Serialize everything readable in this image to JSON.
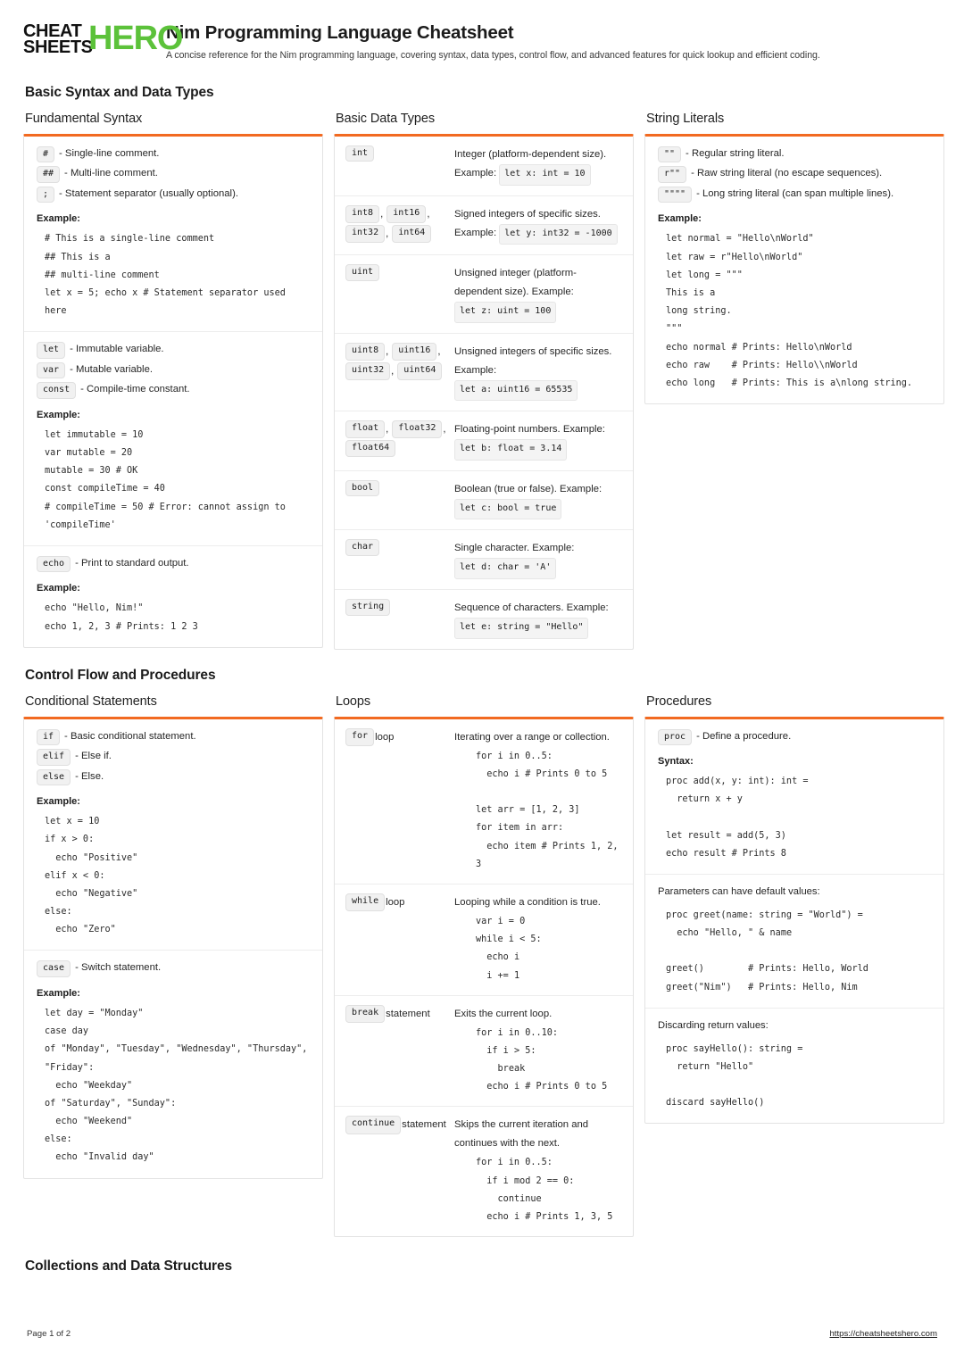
{
  "brand": {
    "line1_black": "CHEAT",
    "line2_black": "SHEETS",
    "hero": "HERO",
    "green": "#5cc23a",
    "accent": "#f26a21"
  },
  "header": {
    "title": "Nim Programming Language Cheatsheet",
    "subtitle": "A concise reference for the Nim programming language, covering syntax, data types, control flow, and advanced features for quick lookup and efficient coding."
  },
  "sections": {
    "basic": "Basic Syntax and Data Types",
    "control": "Control Flow and Procedures",
    "collections": "Collections and Data Structures"
  },
  "labels": {
    "example": "Example:",
    "syntax": "Syntax:"
  },
  "fundamental": {
    "title": "Fundamental Syntax",
    "defs1": [
      {
        "code": "#",
        "text": "- Single-line comment."
      },
      {
        "code": "##",
        "text": "- Multi-line comment."
      },
      {
        "code": ";",
        "text": "- Statement separator (usually optional)."
      }
    ],
    "example1": "# This is a single-line comment\n## This is a\n## multi-line comment\nlet x = 5; echo x # Statement separator used here",
    "defs2": [
      {
        "code": "let",
        "text": "- Immutable variable."
      },
      {
        "code": "var",
        "text": "- Mutable variable."
      },
      {
        "code": "const",
        "text": "- Compile-time constant."
      }
    ],
    "example2": "let immutable = 10\nvar mutable = 20\nmutable = 30 # OK\nconst compileTime = 40\n# compileTime = 50 # Error: cannot assign to 'compileTime'",
    "defs3": [
      {
        "code": "echo",
        "text": "- Print to standard output."
      }
    ],
    "example3": "echo \"Hello, Nim!\"\necho 1, 2, 3 # Prints: 1 2 3"
  },
  "datatypes": {
    "title": "Basic Data Types",
    "rows": [
      {
        "codes": [
          "int"
        ],
        "desc": "Integer (platform-dependent size). Example:",
        "inline": "let x: int = 10"
      },
      {
        "codes": [
          "int8",
          "int16",
          "int32",
          "int64"
        ],
        "desc": "Signed integers of specific sizes. Example:",
        "inline": "let y: int32 = -1000"
      },
      {
        "codes": [
          "uint"
        ],
        "desc": "Unsigned integer (platform-dependent size). Example:",
        "inline": "let z: uint = 100"
      },
      {
        "codes": [
          "uint8",
          "uint16",
          "uint32",
          "uint64"
        ],
        "desc": "Unsigned integers of specific sizes. Example:",
        "inline": "let a: uint16 = 65535"
      },
      {
        "codes": [
          "float",
          "float32",
          "float64"
        ],
        "desc": "Floating-point numbers. Example:",
        "inline": "let b: float = 3.14"
      },
      {
        "codes": [
          "bool"
        ],
        "desc": "Boolean (true or false). Example:",
        "inline": "let c: bool = true"
      },
      {
        "codes": [
          "char"
        ],
        "desc": "Single character. Example:",
        "inline": "let d: char = 'A'"
      },
      {
        "codes": [
          "string"
        ],
        "desc": "Sequence of characters. Example:",
        "inline": "let e: string = \"Hello\""
      }
    ]
  },
  "stringliterals": {
    "title": "String Literals",
    "defs": [
      {
        "code": "\"\"",
        "text": "- Regular string literal."
      },
      {
        "code": "r\"\"",
        "text": "- Raw string literal (no escape sequences)."
      },
      {
        "code": "\"\"\"\"",
        "text": "- Long string literal (can span multiple lines)."
      }
    ],
    "example": "let normal = \"Hello\\nWorld\"\nlet raw = r\"Hello\\nWorld\"\nlet long = \"\"\"\nThis is a\nlong string.\n\"\"\"\necho normal # Prints: Hello\\nWorld\necho raw    # Prints: Hello\\\\nWorld\necho long   # Prints: This is a\\nlong string."
  },
  "conditional": {
    "title": "Conditional Statements",
    "defs1": [
      {
        "code": "if",
        "text": "- Basic conditional statement."
      },
      {
        "code": "elif",
        "text": "- Else if."
      },
      {
        "code": "else",
        "text": "- Else."
      }
    ],
    "example1": "let x = 10\nif x > 0:\n  echo \"Positive\"\nelif x < 0:\n  echo \"Negative\"\nelse:\n  echo \"Zero\"",
    "defs2": [
      {
        "code": "case",
        "text": "- Switch statement."
      }
    ],
    "example2": "let day = \"Monday\"\ncase day\nof \"Monday\", \"Tuesday\", \"Wednesday\", \"Thursday\", \"Friday\":\n  echo \"Weekday\"\nof \"Saturday\", \"Sunday\":\n  echo \"Weekend\"\nelse:\n  echo \"Invalid day\""
  },
  "loops": {
    "title": "Loops",
    "rows": [
      {
        "code": "for",
        "suffix": "loop",
        "desc": "Iterating over a range or collection.",
        "example": "for i in 0..5:\n  echo i # Prints 0 to 5\n\nlet arr = [1, 2, 3]\nfor item in arr:\n  echo item # Prints 1, 2, 3"
      },
      {
        "code": "while",
        "suffix": "loop",
        "desc": "Looping while a condition is true.",
        "example": "var i = 0\nwhile i < 5:\n  echo i\n  i += 1"
      },
      {
        "code": "break",
        "suffix": "statement",
        "desc": "Exits the current loop.",
        "example": "for i in 0..10:\n  if i > 5:\n    break\n  echo i # Prints 0 to 5"
      },
      {
        "code": "continue",
        "suffix": "statement",
        "desc": "Skips the current iteration and continues with the next.",
        "example": "for i in 0..5:\n  if i mod 2 == 0:\n    continue\n  echo i # Prints 1, 3, 5"
      }
    ]
  },
  "procedures": {
    "title": "Procedures",
    "defs": [
      {
        "code": "proc",
        "text": "- Define a procedure."
      }
    ],
    "syntax_example": "proc add(x, y: int): int =\n  return x + y\n\nlet result = add(5, 3)\necho result # Prints 8",
    "defaults_note": "Parameters can have default values:",
    "defaults_example": "proc greet(name: string = \"World\") =\n  echo \"Hello, \" & name\n\ngreet()        # Prints: Hello, World\ngreet(\"Nim\")   # Prints: Hello, Nim",
    "discard_note": "Discarding return values:",
    "discard_example": "proc sayHello(): string =\n  return \"Hello\"\n\ndiscard sayHello()"
  },
  "footer": {
    "page": "Page 1 of 2",
    "url": "https://cheatsheetshero.com"
  }
}
